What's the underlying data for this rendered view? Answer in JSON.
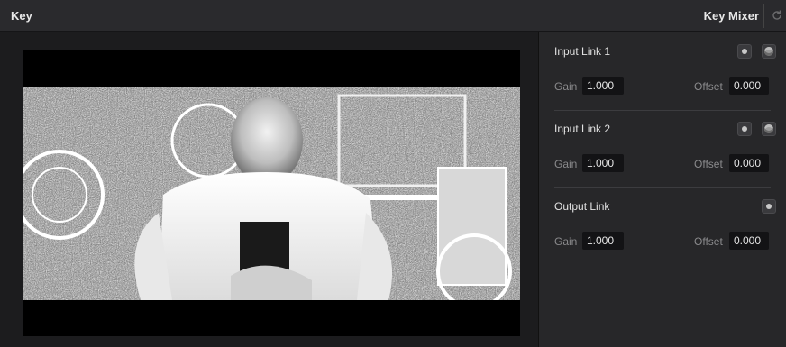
{
  "header": {
    "title": "Key",
    "panel_title": "Key Mixer",
    "reset_icon": "reset-icon"
  },
  "viewer": {
    "description_icon": "key-matte-preview"
  },
  "links": [
    {
      "title": "Input Link 1",
      "gain_label": "Gain",
      "gain": "1.000",
      "offset_label": "Offset",
      "offset": "0.000",
      "has_matte_toggle": true
    },
    {
      "title": "Input Link 2",
      "gain_label": "Gain",
      "gain": "1.000",
      "offset_label": "Offset",
      "offset": "0.000",
      "has_matte_toggle": true
    },
    {
      "title": "Output Link",
      "gain_label": "Gain",
      "gain": "1.000",
      "offset_label": "Offset",
      "offset": "0.000",
      "has_matte_toggle": false
    }
  ],
  "colors": {
    "background": "#1e1e20",
    "panel": "#272729",
    "field": "#131315"
  }
}
